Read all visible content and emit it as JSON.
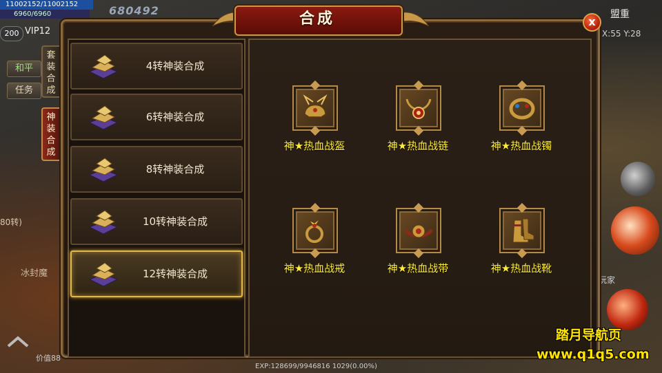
{
  "hud": {
    "hp_text": "11002152/11002152",
    "mp_text": "6960/6960",
    "score": "680492",
    "level": "200",
    "vip": "VIP12",
    "peace_label": "和平",
    "task_label": "任务",
    "alliance": "盟重",
    "coords": "X:55 Y:28",
    "player_label": "玩家",
    "exp_text": "EXP:128699/9946816 1029(0.00%)",
    "lore_1": "80转)",
    "lore_2": "冰封魔",
    "value_text": "价值88"
  },
  "dialog": {
    "title": "合成",
    "close_label": "x",
    "vtabs": [
      {
        "label_chars": [
          "套",
          "装",
          "合",
          "成"
        ],
        "active": false
      },
      {
        "label_chars": [
          "神",
          "装",
          "合",
          "成"
        ],
        "active": true
      }
    ],
    "list": [
      {
        "label": "4转神装合成",
        "selected": false
      },
      {
        "label": "6转神装合成",
        "selected": false
      },
      {
        "label": "8转神装合成",
        "selected": false
      },
      {
        "label": "10转神装合成",
        "selected": false
      },
      {
        "label": "12转神装合成",
        "selected": true
      }
    ],
    "equipment": [
      {
        "name": "神★热血战盔",
        "icon": "helmet-icon"
      },
      {
        "name": "神★热血战链",
        "icon": "necklace-icon"
      },
      {
        "name": "神★热血战镯",
        "icon": "bracelet-icon"
      },
      {
        "name": "神★热血战戒",
        "icon": "ring-icon"
      },
      {
        "name": "神★热血战带",
        "icon": "belt-icon"
      },
      {
        "name": "神★热血战靴",
        "icon": "boots-icon"
      }
    ]
  },
  "watermark": {
    "line1": "踏月导航页",
    "line2": "www.q1q5.com"
  },
  "colors": {
    "equip_name": "#ffee3a",
    "selected_border": "#e0b84e",
    "title_plate": "#8a1a10",
    "watermark": "#ffe400"
  }
}
